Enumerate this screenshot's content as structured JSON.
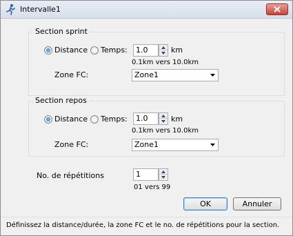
{
  "window": {
    "title": "Intervalle1"
  },
  "sprint": {
    "group_label": "Section sprint",
    "option_distance": "Distance",
    "option_temps": "Temps:",
    "selected": "Distance",
    "value": "1.0",
    "unit": "km",
    "range": "0.1km vers 10.0km",
    "zone_label": "Zone FC:",
    "zone_value": "Zone1"
  },
  "repos": {
    "group_label": "Section repos",
    "option_distance": "Distance",
    "option_temps": "Temps:",
    "selected": "Distance",
    "value": "1.0",
    "unit": "km",
    "range": "0.1km vers 10.0km",
    "zone_label": "Zone FC:",
    "zone_value": "Zone1"
  },
  "repetitions": {
    "label": "No. de répétitions",
    "value": "1",
    "range": "01 vers 99"
  },
  "buttons": {
    "ok": "OK",
    "cancel": "Annuler"
  },
  "status": {
    "text": "Définissez la distance/durée, la zone FC et le no. de répétitions pour la section."
  }
}
